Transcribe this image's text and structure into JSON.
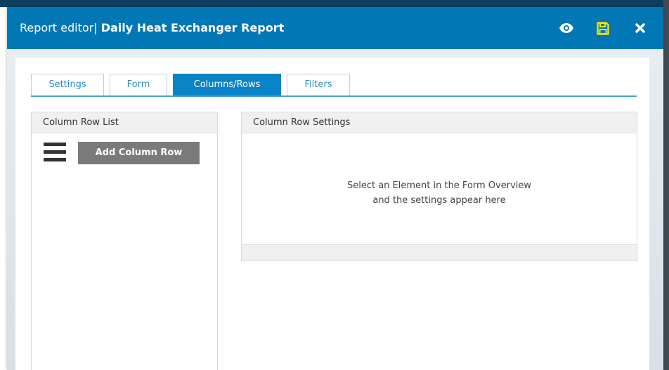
{
  "window": {
    "title_prefix": "Report editor|",
    "title_name": "Daily Heat Exchanger Report",
    "accent_color": "#0277b6",
    "icons": [
      "eye-icon",
      "save-icon",
      "close-icon"
    ]
  },
  "tabs": [
    {
      "label": "Settings",
      "active": false
    },
    {
      "label": "Form",
      "active": false
    },
    {
      "label": "Columns/Rows",
      "active": true
    },
    {
      "label": "Filters",
      "active": false
    }
  ],
  "left_panel": {
    "header": "Column Row List",
    "add_button": "Add Column Row",
    "menu_icon": "hamburger-icon"
  },
  "right_panel": {
    "header": "Column Row Settings",
    "message_line1": "Select an Element in the Form Overview",
    "message_line2": "and the settings appear here"
  }
}
